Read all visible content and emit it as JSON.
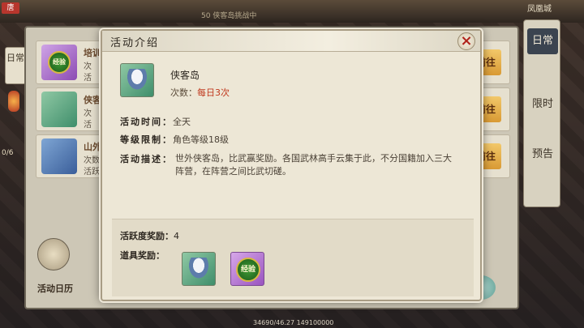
{
  "background": {
    "top_tag": "唐",
    "top_text": "50 侠客岛挑战中",
    "top_right": "凤凰城",
    "bottom_coord": "34690/46.27 149100000"
  },
  "left_tab": "日常",
  "side_num": "0/6",
  "under_rows": [
    {
      "name": "培训",
      "sub1": "次",
      "sub2": "活",
      "button": "前往",
      "icon": "exp-badge-icon",
      "badge": "经验"
    },
    {
      "name": "侠客",
      "sub1": "次",
      "sub2": "活",
      "button": "前往",
      "icon": "knight-figure-icon"
    },
    {
      "name": "山外",
      "sub1": "次数",
      "sub2": "活跃",
      "button": "前往",
      "icon": "chest-icon"
    }
  ],
  "calendar_label": "活动日历",
  "right_tabs": [
    {
      "label": "日常",
      "active": true
    },
    {
      "label": "限时",
      "active": false
    },
    {
      "label": "预告",
      "active": false
    }
  ],
  "modal": {
    "title": "活动介绍",
    "close_icon": "×",
    "activity_name": "侠客岛",
    "times_label": "次数：",
    "times_value": "每日3次",
    "rows": [
      {
        "key": "活动时间：",
        "value": "全天"
      },
      {
        "key": "等级限制：",
        "value": "角色等级18级"
      }
    ],
    "desc_key": "活动描述：",
    "desc": "世外侠客岛，比武赢奖励。各国武林高手云集于此，不分国籍加入三大阵营，在阵营之间比武切磋。",
    "activity_reward_key": "活跃度奖励：",
    "activity_reward_value": "4",
    "item_reward_key": "道具奖励：",
    "item_badge": "经验"
  },
  "colors": {
    "accent_red": "#c0391e",
    "panel_bg": "#ede7d6"
  }
}
